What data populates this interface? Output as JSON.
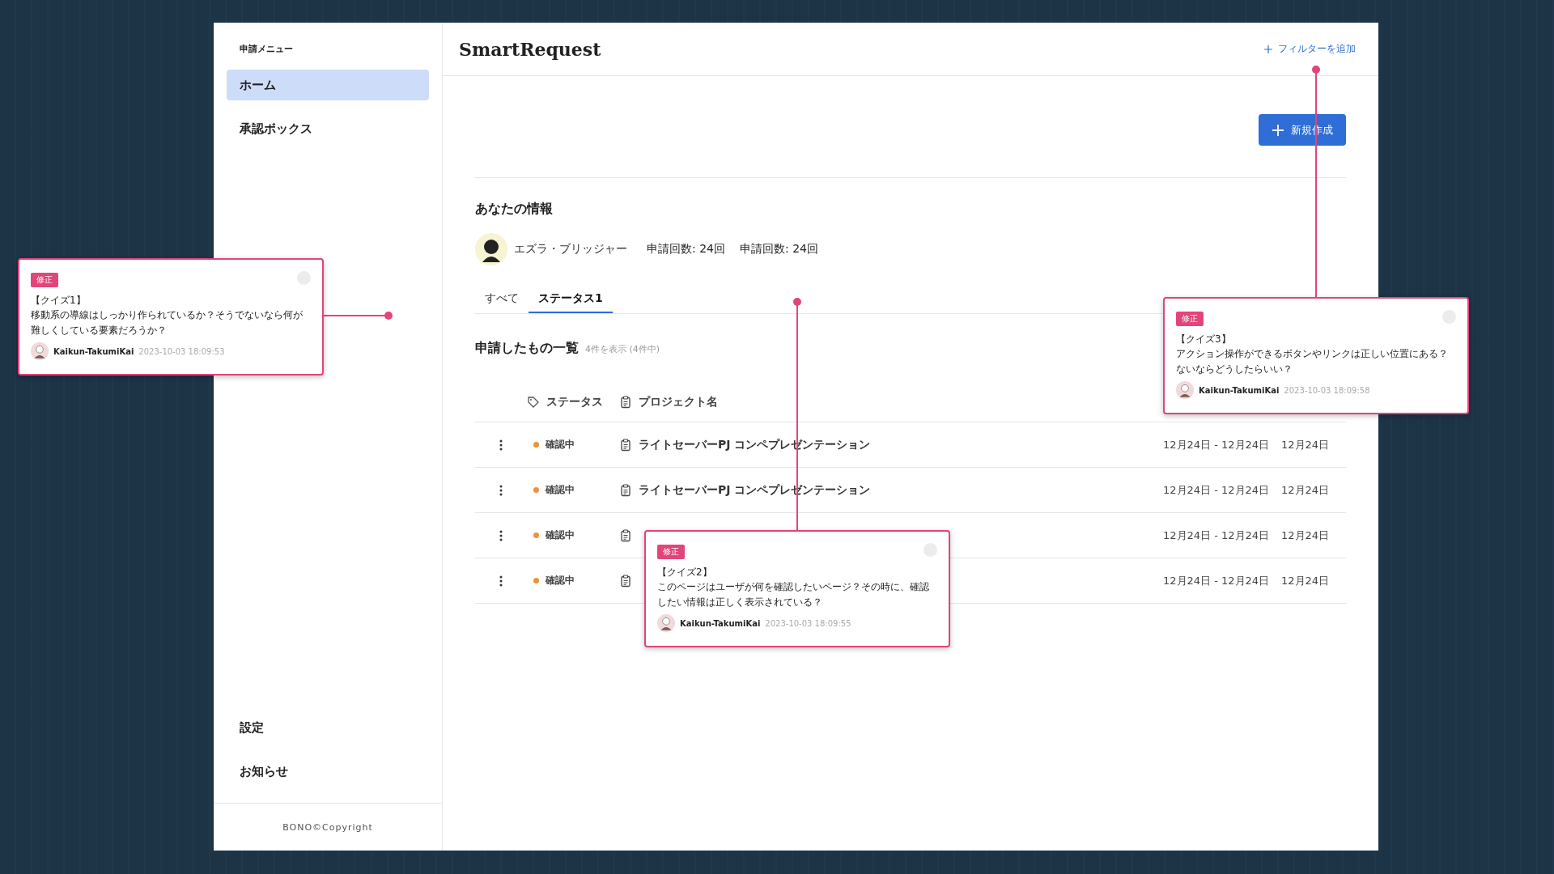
{
  "sidebar": {
    "heading": "申請メニュー",
    "items": [
      {
        "label": "ホーム",
        "selected": true
      },
      {
        "label": "承認ボックス",
        "selected": false
      }
    ],
    "bottom_items": [
      "設定",
      "お知らせ"
    ],
    "footer": "BONO©Copyright"
  },
  "header": {
    "title": "SmartRequest",
    "filter_link": "フィルターを追加"
  },
  "new_button": "新規作成",
  "profile": {
    "heading": "あなたの情報",
    "name": "エズラ・ブリッジャー",
    "stats": [
      "申請回数: 24回",
      "申請回数: 24回"
    ]
  },
  "tabs": [
    {
      "label": "すべて",
      "selected": false
    },
    {
      "label": "ステータス1",
      "selected": true
    }
  ],
  "list": {
    "title": "申請したもの一覧",
    "count": "4件を表示 (4件中)",
    "columns": [
      "ステータス",
      "プロジェクト名"
    ],
    "rows": [
      {
        "status": "確認中",
        "project": "ライトセーバーPJ コンペプレゼンテーション",
        "period": "12月24日 - 12月24日",
        "date": "12月24日"
      },
      {
        "status": "確認中",
        "project": "ライトセーバーPJ コンペプレゼンテーション",
        "period": "12月24日 - 12月24日",
        "date": "12月24日"
      },
      {
        "status": "確認中",
        "period": "12月24日 - 12月24日",
        "date": "12月24日"
      },
      {
        "status": "確認中",
        "period": "12月24日 - 12月24日",
        "date": "12月24日"
      }
    ]
  },
  "comments": [
    {
      "tag": "修正",
      "title": "【クイズ1】",
      "body": "移動系の導線はしっかり作られているか？そうでないなら何が難しくしている要素だろうか？",
      "author": "Kaikun-TakumiKai",
      "time": "2023-10-03 18:09:53"
    },
    {
      "tag": "修正",
      "title": "【クイズ2】",
      "body": "このページはユーザが何を確認したいページ？その時に、確認したい情報は正しく表示されている？",
      "author": "Kaikun-TakumiKai",
      "time": "2023-10-03 18:09:55"
    },
    {
      "tag": "修正",
      "title": "【クイズ3】",
      "body": "アクション操作ができるボタンやリンクは正しい位置にある？ないならどうしたらいい？",
      "author": "Kaikun-TakumiKai",
      "time": "2023-10-03 18:09:58"
    }
  ]
}
